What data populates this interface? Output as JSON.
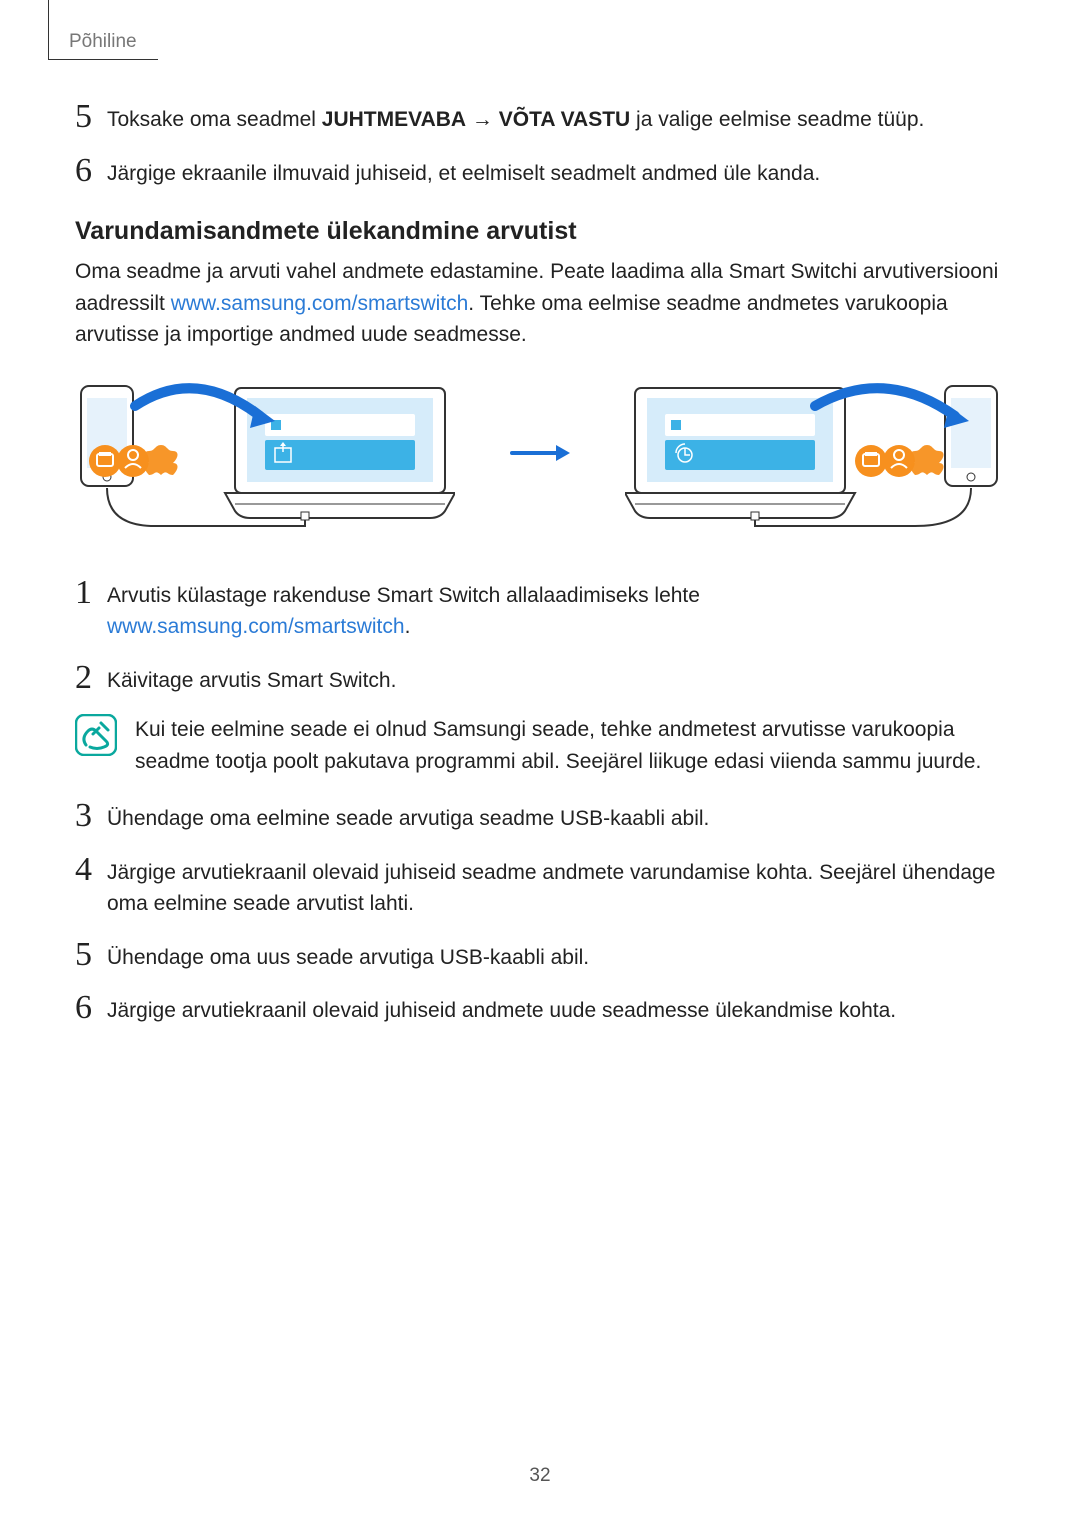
{
  "header": {
    "tab": "Põhiline"
  },
  "top_steps": [
    {
      "num": "5",
      "pre": "Toksake oma seadmel ",
      "bold1": "JUHTMEVABA",
      "arrow": " → ",
      "bold2": "VÕTA VASTU",
      "post": " ja valige eelmise seadme tüüp."
    },
    {
      "num": "6",
      "text": "Järgige ekraanile ilmuvaid juhiseid, et eelmiselt seadmelt andmed üle kanda."
    }
  ],
  "section": {
    "heading": "Varundamisandmete ülekandmine arvutist",
    "para_pre": "Oma seadme ja arvuti vahel andmete edastamine. Peate laadima alla Smart Switchi arvutiversiooni aadressilt ",
    "link1": "www.samsung.com/smartswitch",
    "para_post": ". Tehke oma eelmise seadme andmetes varukoopia arvutisse ja importige andmed uude seadmesse."
  },
  "lower_steps": {
    "s1": {
      "num": "1",
      "pre": "Arvutis külastage rakenduse Smart Switch allalaadimiseks lehte ",
      "link": "www.samsung.com/smartswitch",
      "post": "."
    },
    "s2": {
      "num": "2",
      "text": "Käivitage arvutis Smart Switch."
    },
    "note": "Kui teie eelmine seade ei olnud Samsungi seade, tehke andmetest arvutisse varukoopia seadme tootja poolt pakutava programmi abil. Seejärel liikuge edasi viienda sammu juurde.",
    "s3": {
      "num": "3",
      "text": "Ühendage oma eelmine seade arvutiga seadme USB-kaabli abil."
    },
    "s4": {
      "num": "4",
      "text": "Järgige arvutiekraanil olevaid juhiseid seadme andmete varundamise kohta. Seejärel ühendage oma eelmine seade arvutist lahti."
    },
    "s5": {
      "num": "5",
      "text": "Ühendage oma uus seade arvutiga USB-kaabli abil."
    },
    "s6": {
      "num": "6",
      "text": "Järgige arvutiekraanil olevaid juhiseid andmete uude seadmesse ülekandmise kohta."
    }
  },
  "page_number": "32"
}
